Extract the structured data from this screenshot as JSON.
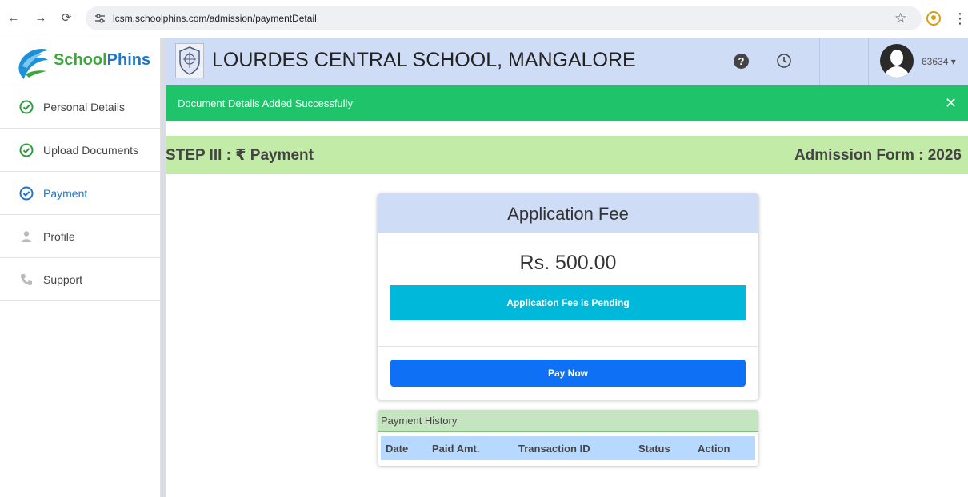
{
  "browser": {
    "url": "lcsm.schoolphins.com/admission/paymentDetail",
    "back_glyph": "←",
    "forward_glyph": "→",
    "reload_glyph": "⟳",
    "star_glyph": "☆",
    "menu_glyph": "⋮"
  },
  "sidebar": {
    "brand_school": "School",
    "brand_phins": "Phins",
    "items": [
      {
        "label": "Personal Details",
        "icon": "check-circle-icon"
      },
      {
        "label": "Upload Documents",
        "icon": "check-circle-icon"
      },
      {
        "label": "Payment",
        "icon": "check-circle-icon"
      },
      {
        "label": "Profile",
        "icon": "user-icon"
      },
      {
        "label": "Support",
        "icon": "phone-icon"
      }
    ]
  },
  "header": {
    "school_name": "LOURDES CENTRAL SCHOOL, MANGALORE",
    "help_glyph": "?",
    "user_id": "63634 ▾"
  },
  "alert": {
    "message": "Document Details Added Successfully",
    "close_glyph": "✕"
  },
  "step": {
    "title": "STEP III : ₹ Payment",
    "form_label": "Admission Form : 2026"
  },
  "fee": {
    "title": "Application Fee",
    "amount": "Rs. 500.00",
    "status": "Application Fee is Pending",
    "pay_button": "Pay Now"
  },
  "history": {
    "title": "Payment History",
    "columns": [
      "Date",
      "Paid Amt.",
      "Transaction ID",
      "Status",
      "Action"
    ]
  },
  "colors": {
    "alert_green": "#1fc46a",
    "step_green": "#c2eba8",
    "header_blue": "#cfdcf6",
    "status_cyan": "#00b8d9",
    "pay_blue": "#0d70f5",
    "check_green": "#2a9d3a",
    "active_blue": "#1f76c8"
  }
}
